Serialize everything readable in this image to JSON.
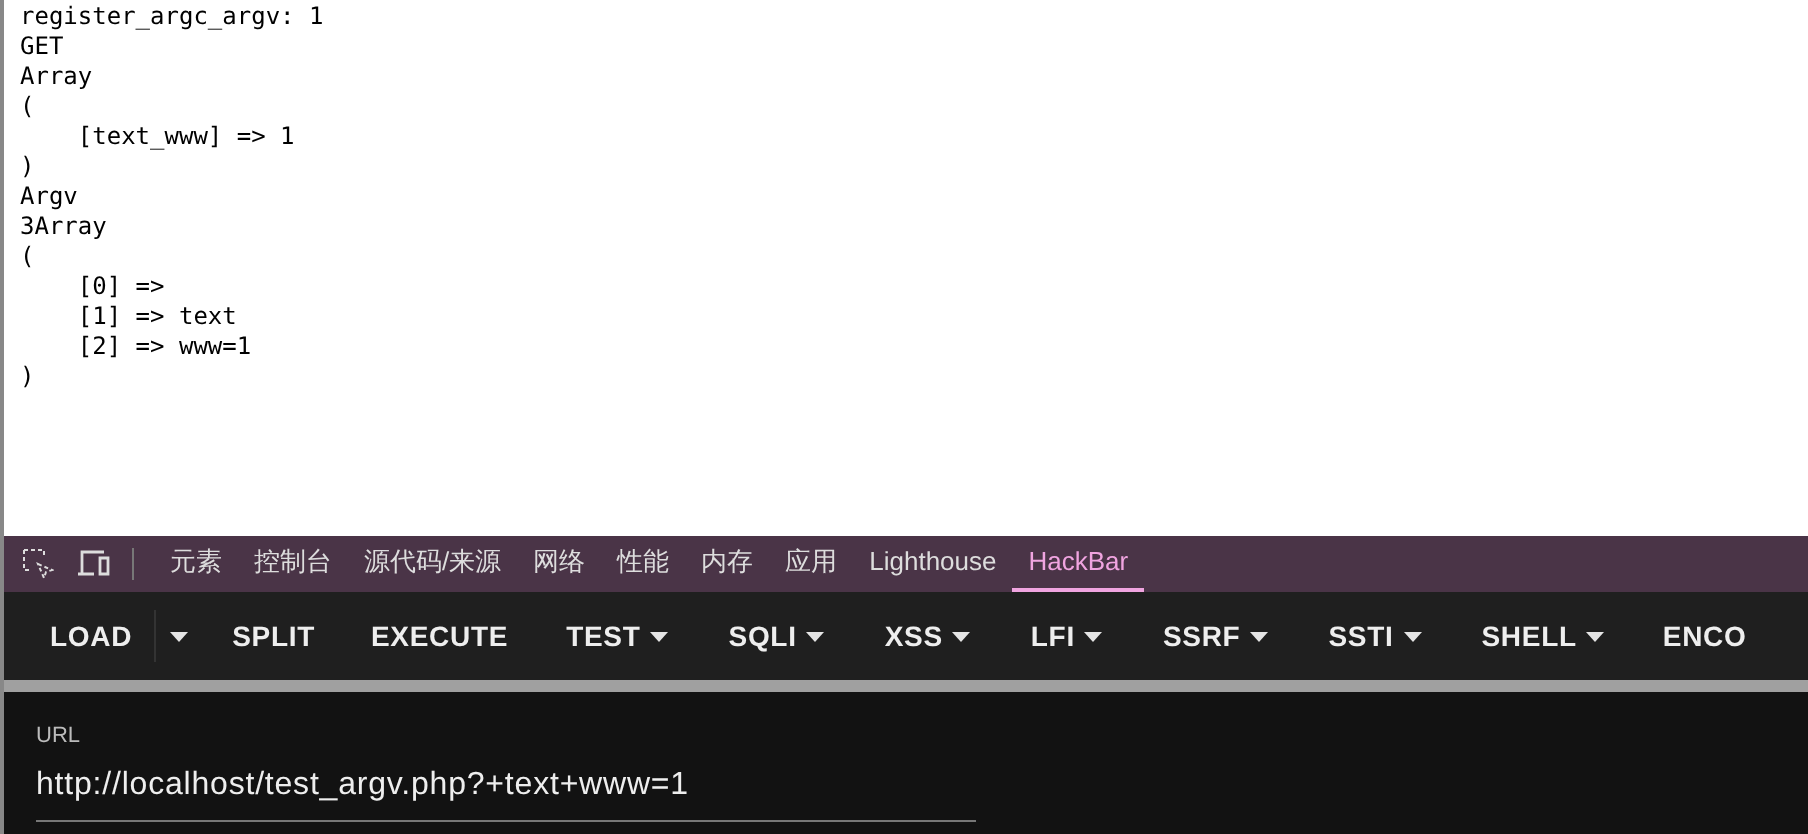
{
  "output": {
    "lines": [
      "register_argc_argv: 1",
      "GET",
      "Array",
      "(",
      "    [text_www] => 1",
      ")",
      "Argv",
      "3Array",
      "(",
      "    [0] =>",
      "    [1] => text",
      "    [2] => www=1",
      ")"
    ]
  },
  "devtools_tabs": [
    {
      "label": "元素",
      "selected": false
    },
    {
      "label": "控制台",
      "selected": false
    },
    {
      "label": "源代码/来源",
      "selected": false
    },
    {
      "label": "网络",
      "selected": false
    },
    {
      "label": "性能",
      "selected": false
    },
    {
      "label": "内存",
      "selected": false
    },
    {
      "label": "应用",
      "selected": false
    },
    {
      "label": "Lighthouse",
      "selected": false
    },
    {
      "label": "HackBar",
      "selected": true
    }
  ],
  "toolbar": [
    {
      "label": "LOAD",
      "kind": "split"
    },
    {
      "label": "SPLIT",
      "kind": "button"
    },
    {
      "label": "EXECUTE",
      "kind": "button"
    },
    {
      "label": "TEST",
      "kind": "dropdown"
    },
    {
      "label": "SQLI",
      "kind": "dropdown"
    },
    {
      "label": "XSS",
      "kind": "dropdown"
    },
    {
      "label": "LFI",
      "kind": "dropdown"
    },
    {
      "label": "SSRF",
      "kind": "dropdown"
    },
    {
      "label": "SSTI",
      "kind": "dropdown"
    },
    {
      "label": "SHELL",
      "kind": "dropdown"
    },
    {
      "label": "ENCO",
      "kind": "button"
    }
  ],
  "url": {
    "label": "URL",
    "value": "http://localhost/test_argv.php?+text+www=1"
  }
}
